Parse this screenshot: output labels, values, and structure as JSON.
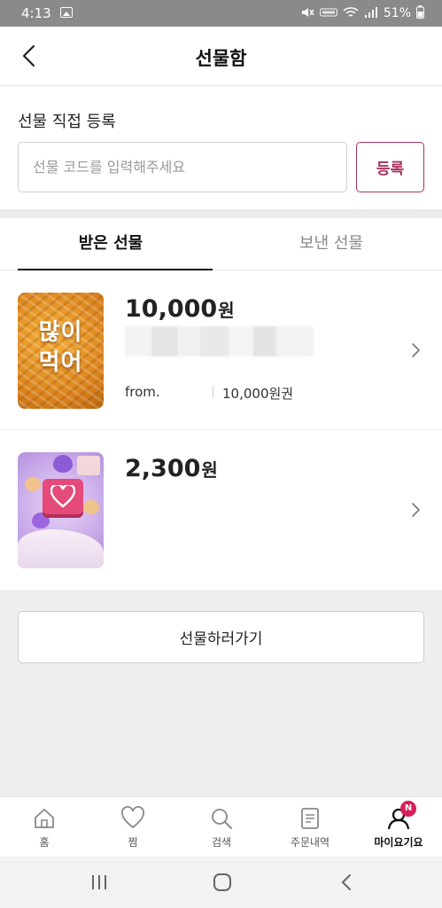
{
  "status_bar": {
    "time": "4:13",
    "battery": "51%",
    "icons": [
      "image-icon",
      "mute-icon",
      "volte-icon",
      "wifi-icon",
      "signal-icon",
      "battery-icon"
    ]
  },
  "header": {
    "title": "선물함",
    "back_icon": "chevron-left-icon"
  },
  "register": {
    "title": "선물 직접 등록",
    "input_placeholder": "선물 코드를 입력해주세요",
    "input_value": "",
    "button_label": "등록"
  },
  "tabs": [
    {
      "label": "받은 선물",
      "active": true
    },
    {
      "label": "보낸 선물",
      "active": false
    }
  ],
  "gifts": [
    {
      "amount": "10,000",
      "unit": "원",
      "thumbnail_text_line1": "많이",
      "thumbnail_text_line2": "먹어",
      "from_label": "from.",
      "voucher": "10,000원권"
    },
    {
      "amount": "2,300",
      "unit": "원"
    }
  ],
  "send_gift_button": "선물하러가기",
  "bottom_nav": [
    {
      "label": "홈",
      "icon": "home-icon"
    },
    {
      "label": "찜",
      "icon": "heart-icon"
    },
    {
      "label": "검색",
      "icon": "search-icon"
    },
    {
      "label": "주문내역",
      "icon": "receipt-icon"
    },
    {
      "label": "마이요기요",
      "icon": "profile-icon",
      "badge": "N",
      "active": true
    }
  ],
  "colors": {
    "accent": "#a8325f",
    "badge": "#d81e5b",
    "status_bar": "#8a8a8a"
  }
}
